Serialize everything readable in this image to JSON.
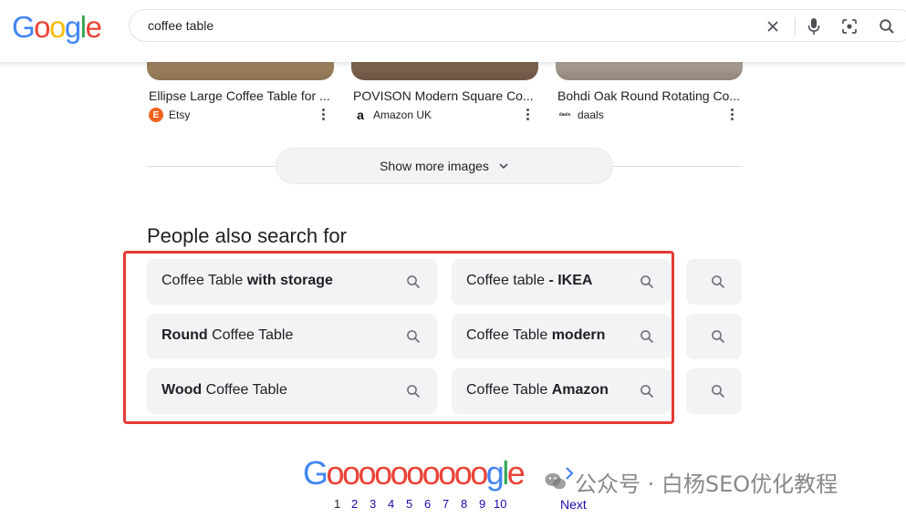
{
  "header": {
    "logo_text": "Google",
    "search_value": "coffee table",
    "icons": [
      "clear-icon",
      "microphone-icon",
      "lens-icon",
      "search-icon"
    ]
  },
  "images": [
    {
      "title": "Ellipse Large Coffee Table for ...",
      "source": "Etsy",
      "source_icon": "E"
    },
    {
      "title": "POVISON Modern Square Co...",
      "source": "Amazon UK",
      "source_icon": "a"
    },
    {
      "title": "Bohdi Oak Round Rotating Co...",
      "source": "daals",
      "source_icon": "daals"
    }
  ],
  "show_more": {
    "label": "Show more images"
  },
  "people_also_search": {
    "title": "People also search for",
    "chips": [
      {
        "plain": "Coffee Table ",
        "bold": "with storage",
        "order": "plain-first"
      },
      {
        "plain": "Coffee table ",
        "bold": "- IKEA",
        "order": "plain-first"
      },
      {
        "plain": "",
        "bold": "",
        "order": "plain-first"
      },
      {
        "plain": " Coffee Table",
        "bold": "Round",
        "order": "bold-first"
      },
      {
        "plain": "Coffee Table ",
        "bold": "modern",
        "order": "plain-first"
      },
      {
        "plain": "",
        "bold": "",
        "order": "plain-first"
      },
      {
        "plain": " Coffee Table",
        "bold": "Wood",
        "order": "bold-first"
      },
      {
        "plain": "Coffee Table ",
        "bold": "Amazon",
        "order": "plain-first"
      },
      {
        "plain": "",
        "bold": "",
        "order": "plain-first"
      }
    ]
  },
  "pagination": {
    "logo": {
      "first": "G",
      "middle": "oooooooooo",
      "last": "gle"
    },
    "pages": [
      "1",
      "2",
      "3",
      "4",
      "5",
      "6",
      "7",
      "8",
      "9",
      "10"
    ],
    "current_page": "1",
    "next_label": "Next"
  },
  "watermark": {
    "text": "公众号 · 白杨SEO优化教程"
  },
  "colors": {
    "blue": "#4285f4",
    "red": "#ea4335",
    "yellow": "#fbbc05",
    "green": "#34a853",
    "link": "#1a0dab",
    "chip_bg": "#f1f3f4",
    "highlight": "#e53935"
  }
}
